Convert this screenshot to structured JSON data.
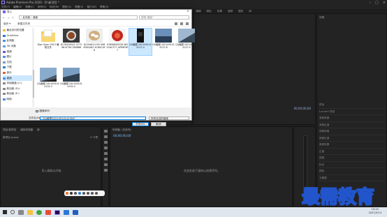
{
  "app": {
    "title": "Adobe Premiere Pro 2020 - D:\\新项目 *",
    "menu": [
      "文件(F)",
      "编辑(E)",
      "剪辑(C)",
      "序列(S)",
      "标记(M)",
      "图形(G)",
      "视图(V)",
      "窗口(W)",
      "帮助(H)"
    ],
    "workspaces": [
      "学习",
      "组件",
      "编辑",
      "颜色",
      "效果",
      "音频",
      "图形",
      "库"
    ]
  },
  "program_panel": {
    "timecode": "00;00;00;00"
  },
  "effects_panel": {
    "title": "效果",
    "items": [
      "预设",
      "Lumetri 预设",
      "音频效果",
      "音频过渡",
      "视频效果",
      "视频过渡",
      "音频效果",
      "过渡",
      "视频",
      "标记",
      "颜色",
      "元数据"
    ]
  },
  "project_panel": {
    "tabs": [
      "项目:新项目",
      "媒体浏览器",
      "库"
    ],
    "project_name": "新项目.prproj",
    "item_count": "0 个项",
    "empty_hint": "导入媒体以开始"
  },
  "timeline_panel": {
    "title": "时间轴: (无序列)",
    "timecode": "00;00;00;00",
    "empty_hint": "在此处放下媒体以创建序列。"
  },
  "dialog": {
    "title": "导入",
    "address": "› 此电脑 › 桌面",
    "search_placeholder": "搜索\"桌面\"",
    "toolbar": {
      "organize": "组织 ▾",
      "new_folder": "新建文件夹"
    },
    "sidebar": [
      {
        "label": "最近访问的位置",
        "color": "#f0c040"
      },
      {
        "label": "OneDrive",
        "color": "#2b7cd3"
      },
      {
        "label": "此电脑",
        "color": "#4a90e2"
      },
      {
        "label": "3D 对象",
        "color": "#5aa0e8"
      },
      {
        "label": "视频",
        "color": "#6a5acd"
      },
      {
        "label": "图片",
        "color": "#4a90e2"
      },
      {
        "label": "文档",
        "color": "#7a9ab8"
      },
      {
        "label": "下载",
        "color": "#2b7cd3"
      },
      {
        "label": "音乐",
        "color": "#e06040"
      },
      {
        "label": "桌面",
        "color": "#4a90e2",
        "selected": true
      },
      {
        "label": "本地磁盘 (C:)",
        "color": "#888888"
      },
      {
        "label": "新加卷 (D:)",
        "color": "#888888"
      },
      {
        "label": "新加卷 (E:)",
        "color": "#888888"
      },
      {
        "label": "网络",
        "color": "#4a90e2"
      }
    ],
    "files": [
      {
        "label": "Wps Open 2013 编辑文件",
        "kind": "folder"
      },
      {
        "label": "8176436541 47729619790 589886",
        "kind": "bowl"
      },
      {
        "label": "81294611195 0988382A82 AC80C288",
        "kind": "eggs"
      },
      {
        "label": "07690809538 5655C6C377 APR9E9E7",
        "kind": "red"
      },
      {
        "label": "QQ截图 2021091414123 4",
        "kind": "phone",
        "selected": true
      },
      {
        "label": "QQ截图 2021091414123 8",
        "kind": "sky"
      },
      {
        "label": "QQ截图 2021091414123 9",
        "kind": "sky2"
      },
      {
        "label": "QQ截图 2021091414130 3",
        "kind": "sky3"
      },
      {
        "label": "QQ截图 2021091414130 4",
        "kind": "sky4"
      }
    ],
    "sequence_checkbox": "图像序列",
    "filename_label": "文件名(N):",
    "filename_value": "\"QQ截图20210914141304\"",
    "filetype": "所有支持的媒体",
    "import_button": "打开(O)",
    "cancel_button": "取消"
  },
  "watermark": "最需教育",
  "taskbar": {
    "time": "19:20",
    "date": "2021/9/14"
  }
}
